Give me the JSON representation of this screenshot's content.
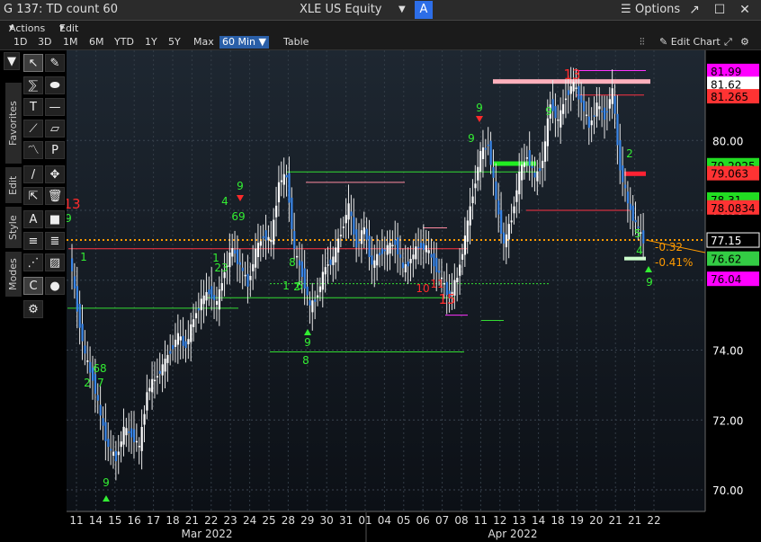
{
  "window": {
    "title": "G 137: TD count 60",
    "security": "XLE US Equity",
    "security_badge": "A",
    "options_label": "Options"
  },
  "menu": {
    "actions": "Actions",
    "edit": "Edit"
  },
  "ranges": [
    "1D",
    "3D",
    "1M",
    "6M",
    "YTD",
    "1Y",
    "5Y",
    "Max",
    "60 Min ▼",
    "Table"
  ],
  "active_range": "60 Min ▼",
  "edit_chart_label": "Edit Chart",
  "side_tabs": [
    "Favorites",
    "Edit",
    "Style",
    "Modes"
  ],
  "chart_data": {
    "type": "candlestick",
    "security": "XLE US Equity",
    "interval": "60 Min",
    "ylim": [
      69.8,
      82.6
    ],
    "y_ticks": [
      "70.00",
      "72.00",
      "74.00",
      "76.00",
      "78.00",
      "80.00"
    ],
    "x_ticks": [
      "11",
      "14",
      "15",
      "16",
      "17",
      "18",
      "21",
      "22",
      "23",
      "24",
      "25",
      "28",
      "29",
      "30",
      "31",
      "01",
      "04",
      "05",
      "06",
      "07",
      "08",
      "11",
      "12",
      "13",
      "14",
      "18",
      "19",
      "20",
      "21",
      "21",
      "22"
    ],
    "month_labels": [
      "Mar 2022",
      "Apr 2022"
    ],
    "grid": true,
    "price_path": [
      76.7,
      75.2,
      73.8,
      73.2,
      72.1,
      71.2,
      70.9,
      71.7,
      71.6,
      71.2,
      72.8,
      73.2,
      73.5,
      74.0,
      74.4,
      74.1,
      74.9,
      75.4,
      75.7,
      75.3,
      76.3,
      76.9,
      76.4,
      75.9,
      76.8,
      77.3,
      77.1,
      78.8,
      79.0,
      76.8,
      76.2,
      75.2,
      75.6,
      76.4,
      76.6,
      77.4,
      78.1,
      77.0,
      77.5,
      76.4,
      76.8,
      76.9,
      77.1,
      76.3,
      76.6,
      77.0,
      76.9,
      76.5,
      76.0,
      75.5,
      76.1,
      77.2,
      78.5,
      79.6,
      79.9,
      78.3,
      77.0,
      77.8,
      79.0,
      79.6,
      78.9,
      79.4,
      81.1,
      80.5,
      81.3,
      81.6,
      81.1,
      80.4,
      81.0,
      80.7,
      81.4,
      79.2,
      78.2,
      77.6,
      77.15
    ],
    "price_levels": [
      {
        "value": "81.99",
        "color": "#ff00ff",
        "text": "#000000"
      },
      {
        "value": "81.62",
        "color": "#ffffff",
        "text": "#000000"
      },
      {
        "value": "81.265",
        "color": "#ff3333",
        "text": "#000000"
      },
      {
        "value": "79.2925",
        "color": "#22dd22",
        "text": "#000000"
      },
      {
        "value": "79.063",
        "color": "#ff3333",
        "text": "#000000"
      },
      {
        "value": "78.31",
        "color": "#22dd22",
        "text": "#000000"
      },
      {
        "value": "78.0834",
        "color": "#ff3333",
        "text": "#000000"
      },
      {
        "value": "77.15",
        "color": "#000000",
        "text": "#ffffff"
      },
      {
        "value": "76.62",
        "color": "#33cc44",
        "text": "#000000"
      },
      {
        "value": "76.04",
        "color": "#ff00ff",
        "text": "#000000"
      }
    ],
    "last_price": 77.15,
    "change": "-0.32",
    "change_pct": "-0.41%",
    "td_labels": [
      {
        "t": "13",
        "c": "red",
        "x": 80,
        "y": 232
      },
      {
        "t": "9",
        "c": "green",
        "x": 76,
        "y": 247
      },
      {
        "t": "1",
        "c": "green",
        "x": 93,
        "y": 290
      },
      {
        "t": "2",
        "c": "green",
        "x": 97,
        "y": 430
      },
      {
        "t": "7",
        "c": "green",
        "x": 112,
        "y": 430
      },
      {
        "t": "68",
        "c": "green",
        "x": 111,
        "y": 414
      },
      {
        "t": "9",
        "c": "green",
        "x": 118,
        "y": 541
      },
      {
        "t": "1",
        "c": "green",
        "x": 240,
        "y": 291
      },
      {
        "t": "23",
        "c": "green",
        "x": 246,
        "y": 302
      },
      {
        "t": "4",
        "c": "green",
        "x": 250,
        "y": 228
      },
      {
        "t": "69",
        "c": "green",
        "x": 265,
        "y": 245
      },
      {
        "t": "9",
        "c": "green",
        "x": 267,
        "y": 211
      },
      {
        "t": "8",
        "c": "green",
        "x": 325,
        "y": 296
      },
      {
        "t": "1",
        "c": "green",
        "x": 318,
        "y": 322
      },
      {
        "t": "2",
        "c": "green",
        "x": 330,
        "y": 323
      },
      {
        "t": "6",
        "c": "green",
        "x": 333,
        "y": 322
      },
      {
        "t": "9",
        "c": "green",
        "x": 342,
        "y": 385
      },
      {
        "t": "8",
        "c": "green",
        "x": 340,
        "y": 405
      },
      {
        "t": "15",
        "c": "red",
        "x": 497,
        "y": 338
      },
      {
        "t": "10",
        "c": "red",
        "x": 470,
        "y": 325
      },
      {
        "t": "11",
        "c": "red",
        "x": 486,
        "y": 320
      },
      {
        "t": "9",
        "c": "green",
        "x": 533,
        "y": 124
      },
      {
        "t": "9",
        "c": "green",
        "x": 524,
        "y": 158
      },
      {
        "t": "13",
        "c": "red",
        "x": 636,
        "y": 88
      },
      {
        "t": "9",
        "c": "green",
        "x": 610,
        "y": 128
      },
      {
        "t": "4",
        "c": "green",
        "x": 711,
        "y": 283
      },
      {
        "t": "5",
        "c": "green",
        "x": 709,
        "y": 264
      },
      {
        "t": "9",
        "c": "green",
        "x": 722,
        "y": 318
      },
      {
        "t": "2",
        "c": "green",
        "x": 700,
        "y": 175
      }
    ]
  }
}
